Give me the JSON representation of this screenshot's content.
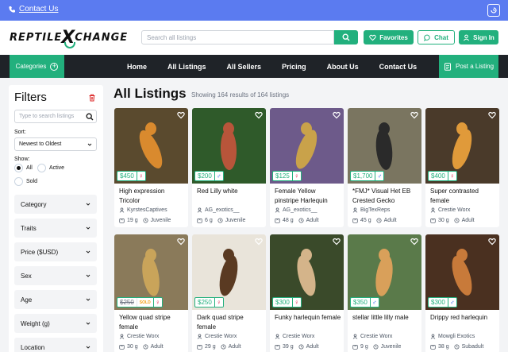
{
  "topbar": {
    "contact": "Contact Us"
  },
  "header": {
    "logo_left": "REPTILE",
    "logo_x": "X",
    "logo_right": "CHANGE",
    "search_placeholder": "Search all listings",
    "favorites": "Favorites",
    "chat": "Chat",
    "signin": "Sign In"
  },
  "nav": {
    "categories": "Categories",
    "items": [
      "Home",
      "All Listings",
      "All Sellers",
      "Pricing",
      "About Us",
      "Contact Us"
    ],
    "post": "Post a Listing"
  },
  "filters": {
    "title": "Filters",
    "search_placeholder": "Type to search listings",
    "sort_label": "Sort:",
    "sort_value": "Newest to Oldest",
    "show_label": "Show:",
    "show_options": [
      "All",
      "Active",
      "Sold"
    ],
    "sections": [
      "Category",
      "Traits",
      "Price ($USD)",
      "Sex",
      "Age",
      "Weight (g)",
      "Location"
    ]
  },
  "main": {
    "title": "All Listings",
    "results": "Showing 164 results of 164 listings"
  },
  "listings": [
    {
      "price": "$450",
      "sex": "♀",
      "sex_class": "f",
      "name": "High expression Tricolor",
      "seller": "KyrstesCaptives",
      "weight": "19 g",
      "age": "Juvenile",
      "bg": "#5a4a2e",
      "accent": "#d98a2e"
    },
    {
      "price": "$200",
      "sex": "♂",
      "sex_class": "m",
      "name": "Red Lilly white",
      "seller": "AG_exotics__",
      "weight": "6 g",
      "age": "Juvenile",
      "bg": "#2f5a2a",
      "accent": "#b8553a"
    },
    {
      "price": "$125",
      "sex": "♀",
      "sex_class": "f",
      "name": "Female Yellow pinstripe Harlequin",
      "seller": "AG_exotics__",
      "weight": "48 g",
      "age": "Adult",
      "bg": "#6d5a8a",
      "accent": "#c9a24a"
    },
    {
      "price": "$1,700",
      "sex": "♂",
      "sex_class": "m",
      "name": "*FMJ* Visual Het EB Crested Gecko",
      "seller": "BigTexReps",
      "weight": "45 g",
      "age": "Adult",
      "bg": "#7a7560",
      "accent": "#2a2a2a"
    },
    {
      "price": "$400",
      "sex": "♀",
      "sex_class": "f",
      "name": "Super contrasted female",
      "seller": "Crestie Worx",
      "weight": "30 g",
      "age": "Adult",
      "bg": "#4a3a2a",
      "accent": "#e09a3a"
    },
    {
      "price": "$250",
      "sold": "SOLD",
      "sex": "♀",
      "sex_class": "f",
      "name": "Yellow quad stripe female",
      "seller": "Crestie Worx",
      "weight": "30 g",
      "age": "Adult",
      "bg": "#8a7a5a",
      "accent": "#c9a45a"
    },
    {
      "price": "$250",
      "sex": "♀",
      "sex_class": "f",
      "name": "Dark quad stripe female",
      "seller": "Crestie Worx",
      "weight": "29 g",
      "age": "Adult",
      "bg": "#e9e4da",
      "accent": "#5a3a22"
    },
    {
      "price": "$300",
      "sex": "♀",
      "sex_class": "f",
      "name": "Funky harlequin female",
      "seller": "Crestie Worx",
      "weight": "39 g",
      "age": "Adult",
      "bg": "#3a4a2a",
      "accent": "#d4b48a"
    },
    {
      "price": "$350",
      "sex": "♂",
      "sex_class": "m",
      "name": "stellar little lilly male",
      "seller": "Crestie Worx",
      "weight": "9 g",
      "age": "Juvenile",
      "bg": "#5a7a4a",
      "accent": "#d9a05a"
    },
    {
      "price": "$300",
      "sex": "♂",
      "sex_class": "m",
      "name": "Drippy red harlequin",
      "seller": "Mowgli Exotics",
      "weight": "38 g",
      "age": "Subadult",
      "bg": "#4a3020",
      "accent": "#c87a3a"
    }
  ]
}
